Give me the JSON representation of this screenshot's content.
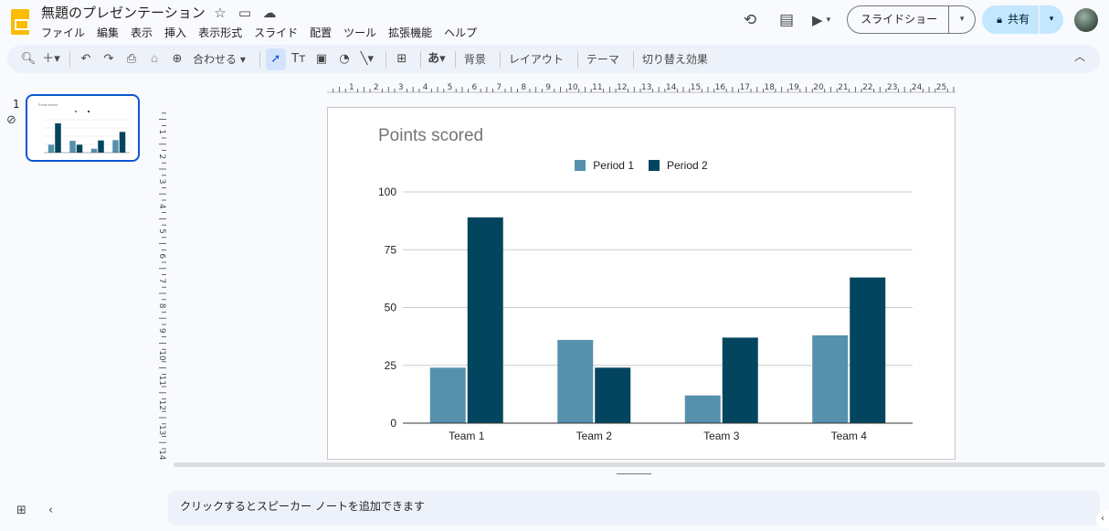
{
  "app": {
    "doc_title": "無題のプレゼンテーション",
    "menu": [
      "ファイル",
      "編集",
      "表示",
      "挿入",
      "表示形式",
      "スライド",
      "配置",
      "ツール",
      "拡張機能",
      "ヘルプ"
    ],
    "icons": [
      "star-icon",
      "move-folder-icon",
      "cloud-saved-icon"
    ]
  },
  "header_actions": {
    "history_icon": "history-icon",
    "comments_icon": "comments-icon",
    "meet_icon": "video-camera-icon",
    "slideshow_label": "スライドショー",
    "share_label": "共有",
    "share_icon": "lock-icon"
  },
  "toolbar": {
    "zoom_label": "合わせる",
    "bg_label": "背景",
    "layout_label": "レイアウト",
    "theme_label": "テーマ",
    "transition_label": "切り替え効果",
    "font_glyph": "あ"
  },
  "filmstrip": {
    "slide_number": "1"
  },
  "ruler": {
    "top": [
      "1",
      "2",
      "3",
      "4",
      "5",
      "6",
      "7",
      "8",
      "9",
      "10",
      "11",
      "12",
      "13",
      "14",
      "15",
      "16",
      "17",
      "18",
      "19",
      "20",
      "21",
      "22",
      "23",
      "24",
      "25"
    ],
    "left": [
      "1",
      "2",
      "3",
      "4",
      "5",
      "6",
      "7",
      "8",
      "9",
      "10",
      "11",
      "12",
      "13",
      "14"
    ]
  },
  "notes": {
    "placeholder": "クリックするとスピーカー ノートを追加できます"
  },
  "colors": {
    "period1": "#5591ad",
    "period2": "#03455e",
    "accent": "#0b57d0",
    "share_bg": "#c2e7ff"
  },
  "chart_data": {
    "type": "bar",
    "title": "Points scored",
    "categories": [
      "Team 1",
      "Team 2",
      "Team 3",
      "Team 4"
    ],
    "series": [
      {
        "name": "Period 1",
        "values": [
          24,
          36,
          12,
          38
        ]
      },
      {
        "name": "Period 2",
        "values": [
          89,
          24,
          37,
          63
        ]
      }
    ],
    "yticks": [
      "0",
      "25",
      "50",
      "75",
      "100"
    ],
    "ylim": [
      0,
      100
    ],
    "grid": true,
    "legend": "top-center"
  }
}
